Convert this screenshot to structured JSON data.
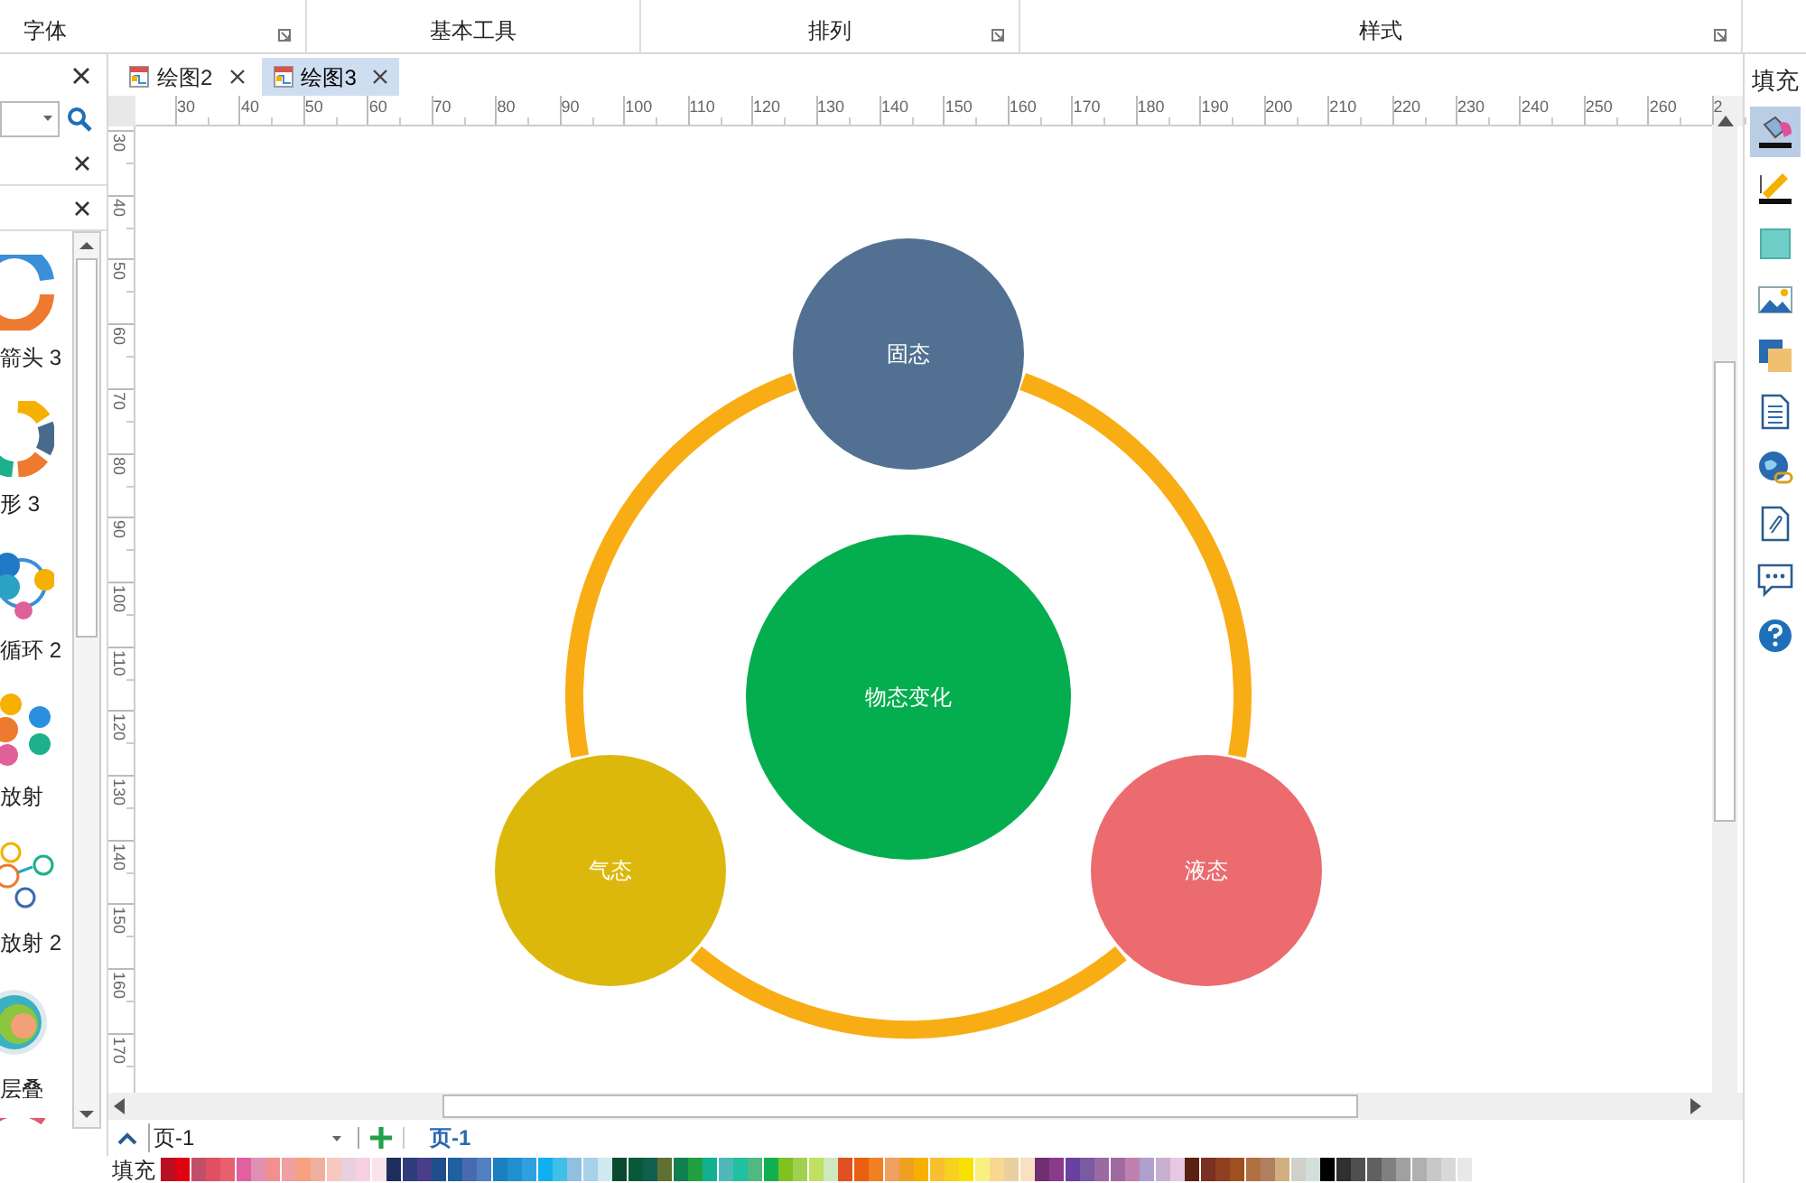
{
  "ribbon": {
    "groups": [
      "字体",
      "基本工具",
      "排列",
      "样式"
    ]
  },
  "library": {
    "items": [
      {
        "kind": "donut-arrow",
        "label": "箭头 3"
      },
      {
        "kind": "donut-segment",
        "label": "形 3"
      },
      {
        "kind": "cycle",
        "label": "循环 2"
      },
      {
        "kind": "radial",
        "label": "放射"
      },
      {
        "kind": "radial-outline",
        "label": "放射 2"
      },
      {
        "kind": "layered",
        "label": "层叠"
      },
      {
        "kind": "partial"
      }
    ]
  },
  "tabs": [
    {
      "label": "绘图2",
      "selected": false
    },
    {
      "label": "绘图3",
      "selected": true
    }
  ],
  "ruler": {
    "h_labels": [
      "30",
      "40",
      "50",
      "60",
      "70",
      "80",
      "90",
      "100",
      "110",
      "120",
      "130",
      "140",
      "150",
      "160",
      "170",
      "180",
      "190",
      "200",
      "210",
      "220",
      "230",
      "240",
      "250",
      "260",
      "2"
    ],
    "v_labels": [
      "30",
      "40",
      "50",
      "60",
      "70",
      "80",
      "90",
      "100",
      "110",
      "120",
      "130",
      "140",
      "150",
      "160",
      "170"
    ]
  },
  "diagram": {
    "ring": {
      "color": "#f9ad14"
    },
    "nodes": [
      {
        "label": "固态",
        "color": "#527192"
      },
      {
        "label": "物态变化",
        "color": "#04ae4f"
      },
      {
        "label": "气态",
        "color": "#ddb80c"
      },
      {
        "label": "液态",
        "color": "#eb6b6f"
      }
    ]
  },
  "pages": {
    "current": "页-1",
    "tabs": [
      {
        "label": "页-1",
        "selected": true
      }
    ]
  },
  "palette": {
    "label": "填充",
    "swatches": [
      {
        "color": "#b81020"
      },
      {
        "color": "#e00010"
      },
      {
        "color": "#c0506a"
      },
      {
        "color": "#e05060"
      },
      {
        "color": "#e86070"
      },
      {
        "color": "#e060a0"
      },
      {
        "color": "#e090b0"
      },
      {
        "color": "#f09090"
      },
      {
        "color": "#f0a0a0"
      },
      {
        "color": "#f8a080"
      },
      {
        "color": "#f0b0a0"
      },
      {
        "color": "#f8c8c0"
      },
      {
        "color": "#e8d0e0"
      },
      {
        "color": "#f8d0e0"
      },
      {
        "color": "#f8e4ea"
      },
      {
        "color": "#1f2d5a"
      },
      {
        "color": "#2e3d7a"
      },
      {
        "color": "#4a3d8a"
      },
      {
        "color": "#1f4e8c"
      },
      {
        "color": "#2060a0"
      },
      {
        "color": "#4a6ab0"
      },
      {
        "color": "#5080c0"
      },
      {
        "color": "#1a80c0"
      },
      {
        "color": "#2090d0"
      },
      {
        "color": "#30a0e0"
      },
      {
        "color": "#10b0f0"
      },
      {
        "color": "#40c0e8"
      },
      {
        "color": "#90c0e0"
      },
      {
        "color": "#a8d0e8"
      },
      {
        "color": "#d0e8f0"
      },
      {
        "color": "#0a4a30"
      },
      {
        "color": "#0a5a3a"
      },
      {
        "color": "#106050"
      },
      {
        "color": "#607030"
      },
      {
        "color": "#108050"
      },
      {
        "color": "#20a040"
      },
      {
        "color": "#10b090"
      },
      {
        "color": "#50b8b8"
      },
      {
        "color": "#20c0a0"
      },
      {
        "color": "#50b880"
      },
      {
        "color": "#10b050"
      },
      {
        "color": "#80c020"
      },
      {
        "color": "#a0d050"
      },
      {
        "color": "#c0e060"
      },
      {
        "color": "#d0e8c0"
      },
      {
        "color": "#e05020"
      },
      {
        "color": "#e86010"
      },
      {
        "color": "#f08020"
      },
      {
        "color": "#f0a060"
      },
      {
        "color": "#f0a020"
      },
      {
        "color": "#f8b000"
      },
      {
        "color": "#f8c030"
      },
      {
        "color": "#f8d020"
      },
      {
        "color": "#f8e000"
      },
      {
        "color": "#f8f080"
      },
      {
        "color": "#f8d890"
      },
      {
        "color": "#e8d0a0"
      },
      {
        "color": "#f8e0c0"
      },
      {
        "color": "#703070"
      },
      {
        "color": "#8a3a8a"
      },
      {
        "color": "#6a40a0"
      },
      {
        "color": "#7a5aa0"
      },
      {
        "color": "#9a6aa0"
      },
      {
        "color": "#a06aa0"
      },
      {
        "color": "#c080b0"
      },
      {
        "color": "#b0a0d0"
      },
      {
        "color": "#c8b0d0"
      },
      {
        "color": "#e8c8e0"
      },
      {
        "color": "#5a2010"
      },
      {
        "color": "#7a3020"
      },
      {
        "color": "#904020"
      },
      {
        "color": "#a05020"
      },
      {
        "color": "#b07040"
      },
      {
        "color": "#b08060"
      },
      {
        "color": "#d0b080"
      },
      {
        "color": "#d0d0c8"
      },
      {
        "color": "#d0e0d8"
      },
      {
        "color": "#000000"
      },
      {
        "color": "#303030"
      },
      {
        "color": "#505050"
      },
      {
        "color": "#606060"
      },
      {
        "color": "#808080"
      },
      {
        "color": "#a0a0a0"
      },
      {
        "color": "#b0b0b0"
      },
      {
        "color": "#c8c8c8"
      },
      {
        "color": "#d8d8d8"
      },
      {
        "color": "#e8e8e8"
      }
    ]
  },
  "side_panel": {
    "title": "填充",
    "tools": [
      {
        "kind": "fill",
        "selected": true
      },
      {
        "kind": "line",
        "selected": false
      },
      {
        "kind": "shadow-square",
        "selected": false
      },
      {
        "kind": "image",
        "selected": false
      },
      {
        "kind": "layers",
        "selected": false
      },
      {
        "kind": "document",
        "selected": false
      },
      {
        "kind": "hyperlink",
        "selected": false
      },
      {
        "kind": "attachment",
        "selected": false
      },
      {
        "kind": "comment",
        "selected": false
      },
      {
        "kind": "help",
        "selected": false
      }
    ]
  }
}
